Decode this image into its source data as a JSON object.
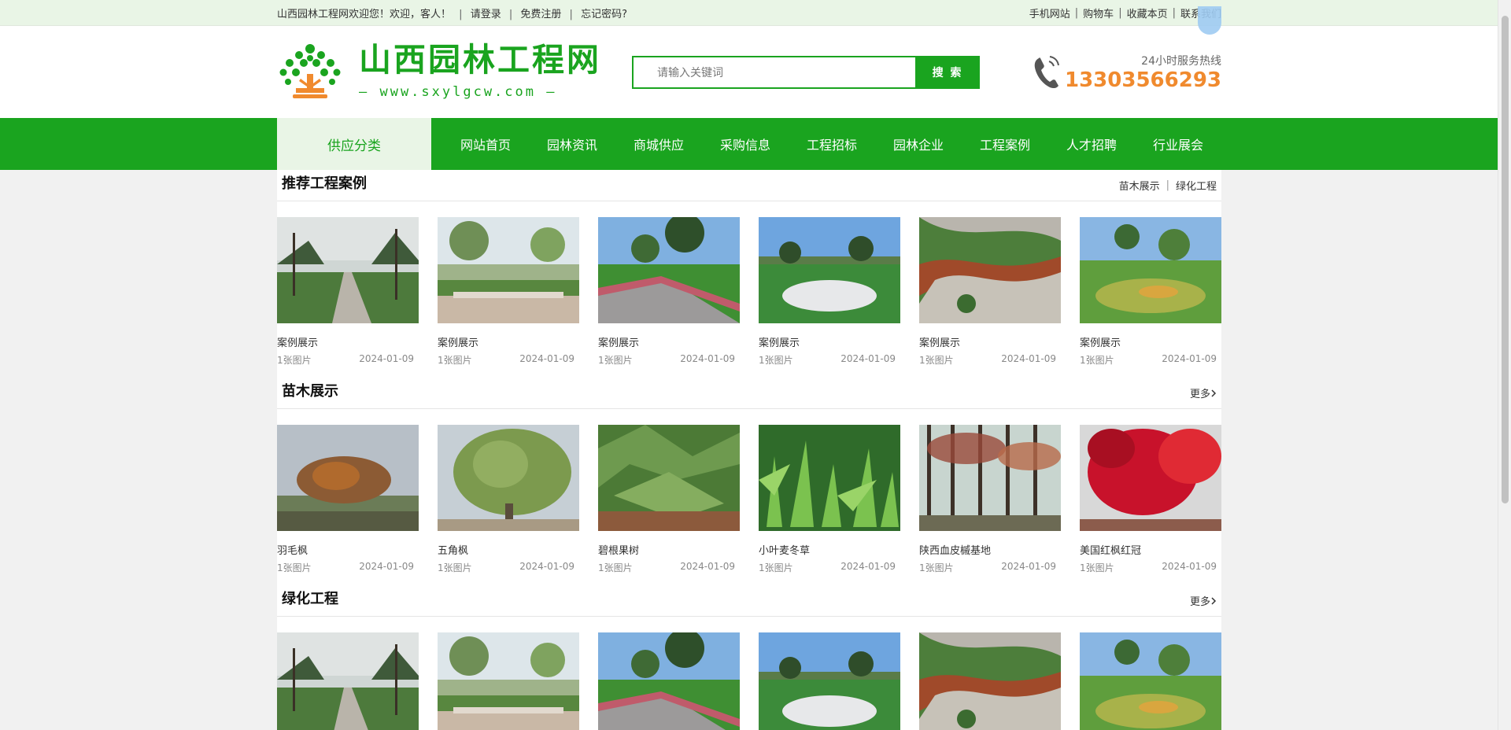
{
  "topbar": {
    "welcome": "山西园林工程网欢迎您！欢迎，客人！",
    "login": "请登录",
    "register": "免费注册",
    "forgot": "忘记密码?",
    "right_links": [
      "手机网站",
      "购物车",
      "收藏本页",
      "联系我们"
    ]
  },
  "header": {
    "logo_cn": "山西园林工程网",
    "logo_en": "— www.sxylgcw.com —",
    "search_placeholder": "请输入关键词",
    "search_button": "搜 索",
    "hotline_label": "24小时服务热线",
    "hotline_number": "13303566293"
  },
  "nav": {
    "category": "供应分类",
    "items": [
      "网站首页",
      "园林资讯",
      "商城供应",
      "采购信息",
      "工程招标",
      "园林企业",
      "工程案例",
      "人才招聘",
      "行业展会"
    ]
  },
  "sections": [
    {
      "title": "推荐工程案例",
      "links": [
        "苗木展示",
        "绿化工程"
      ],
      "cards": [
        {
          "name": "案例展示",
          "count": "1张图片",
          "date": "2024-01-09",
          "scene": "path"
        },
        {
          "name": "案例展示",
          "count": "1张图片",
          "date": "2024-01-09",
          "scene": "plaza"
        },
        {
          "name": "案例展示",
          "count": "1张图片",
          "date": "2024-01-09",
          "scene": "walkway"
        },
        {
          "name": "案例展示",
          "count": "1张图片",
          "date": "2024-01-09",
          "scene": "lawn"
        },
        {
          "name": "案例展示",
          "count": "1张图片",
          "date": "2024-01-09",
          "scene": "curve"
        },
        {
          "name": "案例展示",
          "count": "1张图片",
          "date": "2024-01-09",
          "scene": "garden"
        }
      ]
    },
    {
      "title": "苗木展示",
      "more": "更多",
      "cards": [
        {
          "name": "羽毛枫",
          "count": "1张图片",
          "date": "2024-01-09",
          "scene": "maple"
        },
        {
          "name": "五角枫",
          "count": "1张图片",
          "date": "2024-01-09",
          "scene": "bigtree"
        },
        {
          "name": "碧根果树",
          "count": "1张图片",
          "date": "2024-01-09",
          "scene": "pecan"
        },
        {
          "name": "小叶麦冬草",
          "count": "1张图片",
          "date": "2024-01-09",
          "scene": "grass"
        },
        {
          "name": "陕西血皮槭基地",
          "count": "1张图片",
          "date": "2024-01-09",
          "scene": "forest"
        },
        {
          "name": "美国红枫红冠",
          "count": "1张图片",
          "date": "2024-01-09",
          "scene": "redmaple"
        }
      ]
    },
    {
      "title": "绿化工程",
      "more": "更多",
      "cards": [
        {
          "scene": "path"
        },
        {
          "scene": "plaza"
        },
        {
          "scene": "walkway"
        },
        {
          "scene": "lawn"
        },
        {
          "scene": "curve"
        },
        {
          "scene": "garden"
        }
      ]
    }
  ],
  "colors": {
    "brand_green": "#1aa41f",
    "topbar_bg": "#e9f5e6",
    "hotline_orange": "#f08a2e"
  }
}
